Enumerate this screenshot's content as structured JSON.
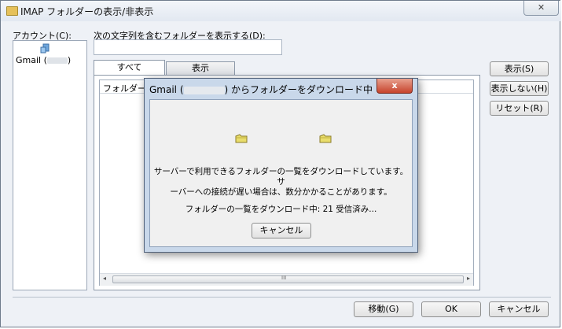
{
  "window": {
    "title": "IMAP フォルダーの表示/非表示",
    "close_glyph": "✕"
  },
  "account": {
    "label": "アカウント(C):",
    "item_prefix": "Gmail (",
    "item_suffix": ")",
    "icon": "account-icon"
  },
  "filter": {
    "label": "次の文字列を含むフォルダーを表示する(D):",
    "value": ""
  },
  "tabs": [
    {
      "label": "すべて"
    },
    {
      "label": "表示"
    }
  ],
  "list": {
    "column_header": "フォルダー",
    "scroll_grip": "III"
  },
  "side_buttons": {
    "show": "表示(S)",
    "hide": "表示しない(H)",
    "reset": "リセット(R)"
  },
  "bottom_buttons": {
    "move": "移動(G)",
    "ok": "OK",
    "cancel": "キャンセル"
  },
  "dialog": {
    "title_prefix": "Gmail (",
    "title_suffix": ") からフォルダーをダウンロード中",
    "close_glyph": "x",
    "message_line1": "サーバーで利用できるフォルダーの一覧をダウンロードしています。サ",
    "message_line2": "ーバーへの接続が遅い場合は、数分かかることがあります。",
    "status": "フォルダーの一覧をダウンロード中:  21 受信済み...",
    "cancel_label": "キャンセル"
  },
  "colors": {
    "window_bg": "#eef1f6",
    "dialog_frame": "#c9d8ea",
    "close_red": "#c6432c",
    "folder_yellow": "#e9dd6c"
  }
}
